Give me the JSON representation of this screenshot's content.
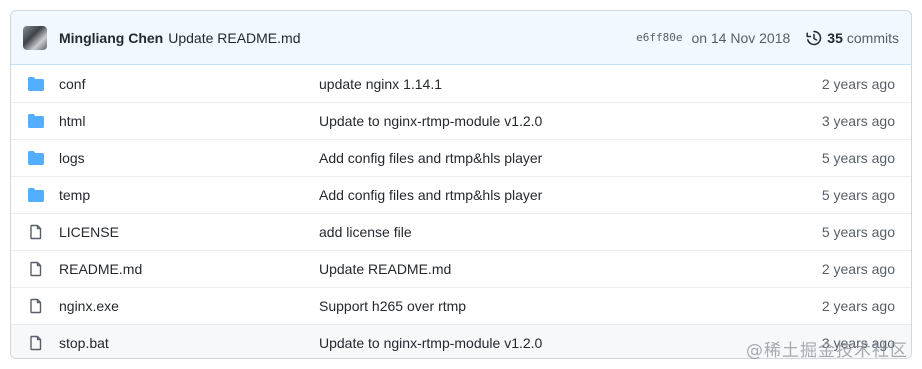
{
  "commit": {
    "author": "Mingliang Chen",
    "message": "Update README.md",
    "sha": "e6ff80e",
    "date": "on 14 Nov 2018",
    "commit_count": "35",
    "commit_word": "commits"
  },
  "files": [
    {
      "type": "folder",
      "name": "conf",
      "message": "update nginx 1.14.1",
      "age": "2 years ago"
    },
    {
      "type": "folder",
      "name": "html",
      "message": "Update to nginx-rtmp-module v1.2.0",
      "age": "3 years ago"
    },
    {
      "type": "folder",
      "name": "logs",
      "message": "Add config files and rtmp&hls player",
      "age": "5 years ago"
    },
    {
      "type": "folder",
      "name": "temp",
      "message": "Add config files and rtmp&hls player",
      "age": "5 years ago"
    },
    {
      "type": "file",
      "name": "LICENSE",
      "message": "add license file",
      "age": "5 years ago"
    },
    {
      "type": "file",
      "name": "README.md",
      "message": "Update README.md",
      "age": "2 years ago"
    },
    {
      "type": "file",
      "name": "nginx.exe",
      "message": "Support h265 over rtmp",
      "age": "2 years ago"
    },
    {
      "type": "file",
      "name": "stop.bat",
      "message": "Update to nginx-rtmp-module v1.2.0",
      "age": "3 years ago"
    }
  ],
  "watermark": "@稀土掘金技术社区",
  "colors": {
    "folder": "#54aeff",
    "file_icon": "#57606a",
    "header_bg": "#f1f8ff",
    "border": "#d0d7de"
  }
}
